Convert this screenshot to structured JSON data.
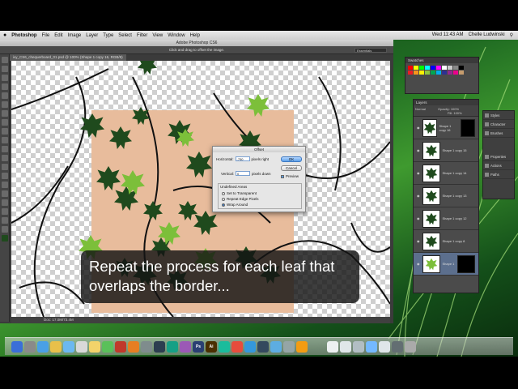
{
  "menubar": {
    "apple": "",
    "app": "Photoshop",
    "items": [
      "File",
      "Edit",
      "Image",
      "Layer",
      "Type",
      "Select",
      "Filter",
      "View",
      "Window",
      "Help"
    ],
    "clock": "Wed 11:43 AM",
    "user": "Chelle Ludwinski"
  },
  "ps": {
    "title": "Adobe Photoshop CS6",
    "options_hint": "Click and drag to offset the image.",
    "workspace": "Essentials",
    "doc_tab": "ivy_CS6_chequerboard_01.psd @ 100% (Shape 1 copy 16, RGB/8)",
    "status": "Doc: 17.0M/73.4M"
  },
  "dialog": {
    "title": "Offset",
    "horizontal_label": "Horizontal:",
    "horizontal_value": "-750",
    "horizontal_unit": "pixels right",
    "vertical_label": "Vertical:",
    "vertical_value": "0",
    "vertical_unit": "pixels down",
    "ok": "OK",
    "cancel": "Cancel",
    "preview": "Preview",
    "group_label": "Undefined Areas",
    "options": [
      "Set to Transparent",
      "Repeat Edge Pixels",
      "Wrap Around"
    ],
    "selected_option": 2
  },
  "panels": {
    "swatches_title": "Swatches",
    "layers_title": "Layers",
    "blend_mode": "Normal",
    "opacity_label": "Opacity:",
    "opacity_value": "100%",
    "fill_label": "Fill:",
    "fill_value": "100%",
    "layers": [
      {
        "name": "Shape 1 copy 16",
        "selected": false
      },
      {
        "name": "Shape 1 copy 15",
        "selected": false
      },
      {
        "name": "Shape 1 copy 14",
        "selected": false
      },
      {
        "name": "Shape 1 copy 13",
        "selected": false
      },
      {
        "name": "Shape 1 copy 12",
        "selected": false
      },
      {
        "name": "Shape 1 copy 8",
        "selected": false
      },
      {
        "name": "Shape 1",
        "selected": true
      }
    ],
    "side": [
      "Styles",
      "Character",
      "Brushes",
      "Properties",
      "Actions",
      "Paths"
    ]
  },
  "colors": {
    "tile": "#e8bc9c",
    "leaf_dark": "#1f4a1d",
    "leaf_light": "#7cbf3a",
    "accent": "#5a9ee8"
  },
  "caption": {
    "line1": "Repeat the process for each leaf that",
    "line2": "overlaps the border..."
  }
}
